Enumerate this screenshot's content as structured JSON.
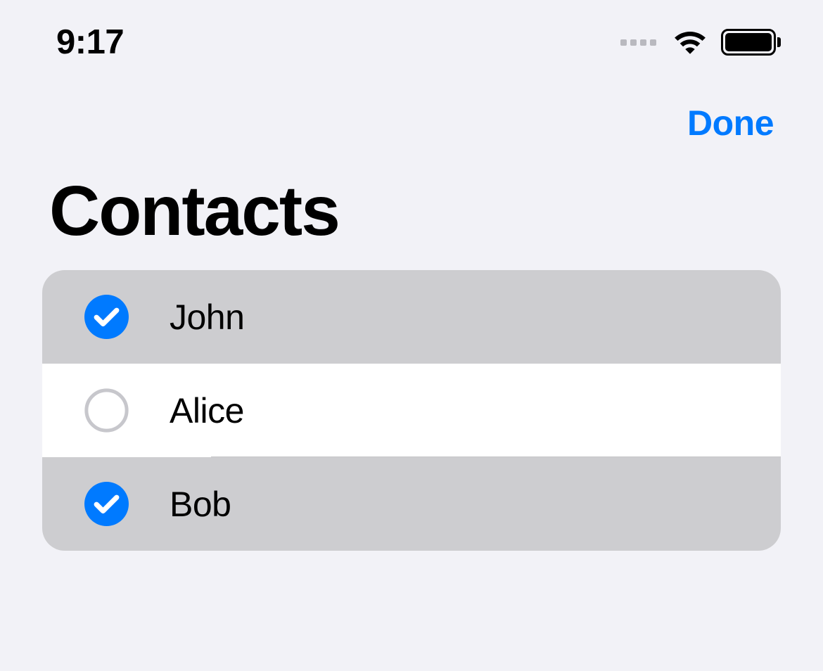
{
  "statusbar": {
    "time": "9:17"
  },
  "nav": {
    "done_label": "Done"
  },
  "header": {
    "title": "Contacts"
  },
  "contacts": [
    {
      "name": "John",
      "selected": true
    },
    {
      "name": "Alice",
      "selected": false
    },
    {
      "name": "Bob",
      "selected": true
    }
  ],
  "colors": {
    "accent": "#007aff",
    "background": "#f2f2f7",
    "selected_row": "#cdcdd0"
  }
}
